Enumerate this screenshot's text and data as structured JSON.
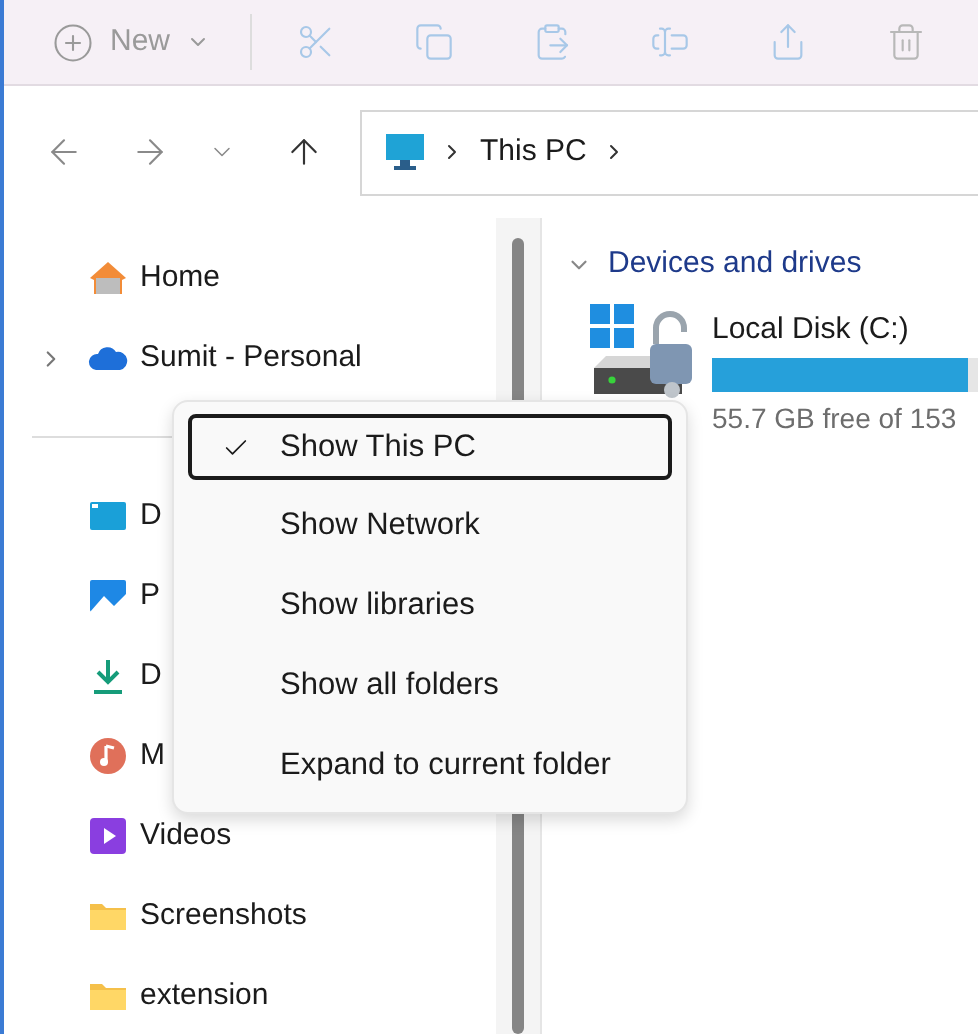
{
  "toolbar": {
    "new_button": {
      "label": "New",
      "disabled": true
    },
    "actions": [
      {
        "kind": "cut",
        "disabled": true
      },
      {
        "kind": "copy",
        "disabled": true
      },
      {
        "kind": "paste",
        "disabled": true
      },
      {
        "kind": "rename",
        "disabled": true
      },
      {
        "kind": "share",
        "disabled": true
      },
      {
        "kind": "delete",
        "disabled": true
      }
    ]
  },
  "address_bar": {
    "path": [
      "This PC"
    ]
  },
  "sidebar": {
    "items": [
      {
        "label": "Home",
        "kind": "home",
        "expandable": false
      },
      {
        "label": "Sumit - Personal",
        "kind": "cloud",
        "expandable": true
      },
      {
        "label": "D",
        "kind": "desktop",
        "expandable": false
      },
      {
        "label": "P",
        "kind": "pictures",
        "expandable": false
      },
      {
        "label": "D",
        "kind": "downloads",
        "expandable": false
      },
      {
        "label": "M",
        "kind": "music",
        "expandable": false
      },
      {
        "label": "Videos",
        "kind": "videos",
        "expandable": false
      },
      {
        "label": "Screenshots",
        "kind": "folder",
        "expandable": false
      },
      {
        "label": "extension",
        "kind": "folder",
        "expandable": false
      }
    ]
  },
  "content": {
    "section": {
      "title": "Devices and drives",
      "expanded": true
    },
    "drives": [
      {
        "name": "Local Disk (C:)",
        "level": 0.64,
        "free_text": "55.7 GB free of 153"
      }
    ]
  },
  "context_menu": {
    "items": [
      {
        "label": "Show This PC",
        "checked": true,
        "selected": true
      },
      {
        "label": "Show Network",
        "checked": false,
        "selected": false
      },
      {
        "label": "Show libraries",
        "checked": false,
        "selected": false
      },
      {
        "label": "Show all folders",
        "checked": false,
        "selected": false
      },
      {
        "label": "Expand to current folder",
        "checked": false,
        "selected": false
      }
    ]
  }
}
